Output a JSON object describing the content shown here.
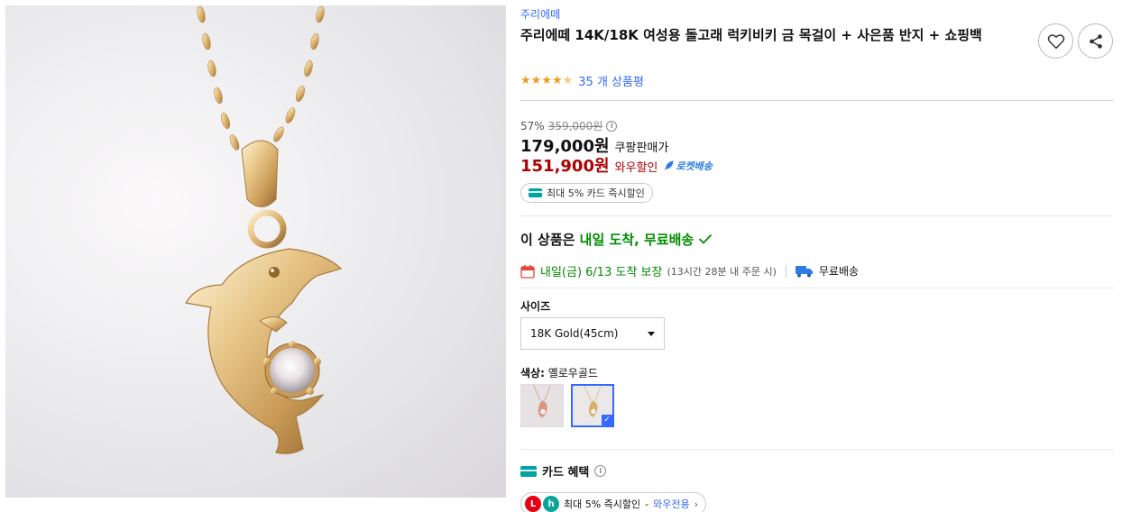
{
  "product": {
    "brand": "주리에떼",
    "title": "주리에떼 14K/18K 여성용 돌고래 럭키비키 금 목걸이 + 사은품 반지 + 쇼핑백",
    "rating_stars": 4.5,
    "review_count_text": "35 개 상품평"
  },
  "price": {
    "discount_rate": "57%",
    "original": "359,000원",
    "sale": "179,000원",
    "sale_label": "쿠팡판매가",
    "wow": "151,900원",
    "wow_label": "와우할인",
    "rocket_label": "로켓배송",
    "card_pill": "최대 5% 카드 즉시할인"
  },
  "shipping": {
    "headline_prefix": "이 상품은 ",
    "headline_green": "내일 도착, 무료배송",
    "date_text": "내일(금) 6/13 도착 보장",
    "date_sub": "(13시간 28분 내 주문 시)",
    "free_label": "무료배송"
  },
  "options": {
    "size_label": "사이즈",
    "size_selected": "18K Gold(45cm)",
    "color_label": "색상:",
    "color_value": "옐로우골드",
    "color_swatches": [
      {
        "name": "rose-gold",
        "selected": false
      },
      {
        "name": "yellow-gold",
        "selected": true
      }
    ]
  },
  "benefits": {
    "title": "카드 혜택",
    "card_text": "최대 5% 즉시할인",
    "wow_only": "와우전용"
  },
  "colors": {
    "link_blue": "#346aff",
    "wow_red": "#ae0000",
    "green": "#008c00",
    "star": "#f19a1c"
  }
}
